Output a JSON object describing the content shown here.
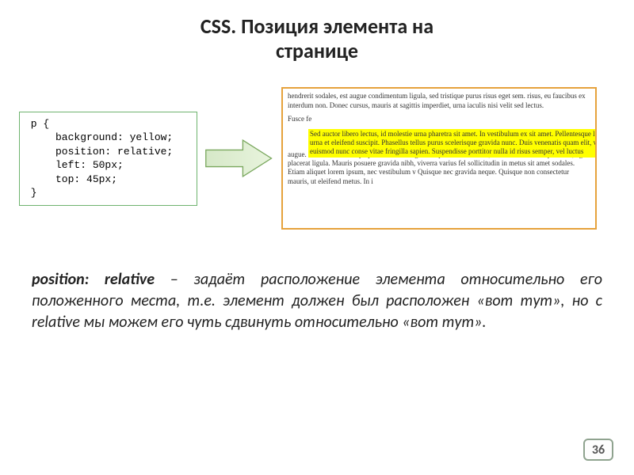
{
  "title_line1": "CSS. Позиция элемента на",
  "title_line2": "странице",
  "code": " p {\n     background: yellow;\n     position: relative;\n     left: 50px;\n     top: 45px;\n }",
  "preview": {
    "para_top": "hendrerit sodales, est augue condimentum ligula, sed tristique purus risus eget sem. risus, eu faucibus ex interdum non. Donec cursus, mauris at sagittis imperdiet, urna iaculis nisi velit sed lectus.",
    "para_bg_lead": "Fusce fe",
    "para_bg_rest": "augue. Cum aliam massapo potentosci et magnis dis parturient montes, nascetur rim consequat odio, eget placerat ligula. Mauris posuere gravida nibh, viverra varius fel sollicitudin in metus sit amet sodales. Etiam aliquet lorem ipsum, nec vestibulum v Quisque nec gravida neque. Quisque non consectetur mauris, ut eleifend metus. In i",
    "yellow_text": "Sed auctor libero lectus, id molestie urna pharetra sit amet. In vestibulum ex sit amet. Pellentesque lacinia urna et eleifend suscipit. Phasellus tellus purus scelerisque gravida nunc. Duis venenatis quam elit, vel euismod nunc conse vitae fringilla sapien. Suspendisse porttitor nulla id risus semper, vel luctus"
  },
  "desc_kw": "position: relative",
  "desc_rest": " – задаёт расположение элемента относительно его положенного места, т.е. элемент должен был расположен «вот тут», но с relative мы можем его чуть сдвинуть относительно «вот тут».",
  "page_number": "36"
}
